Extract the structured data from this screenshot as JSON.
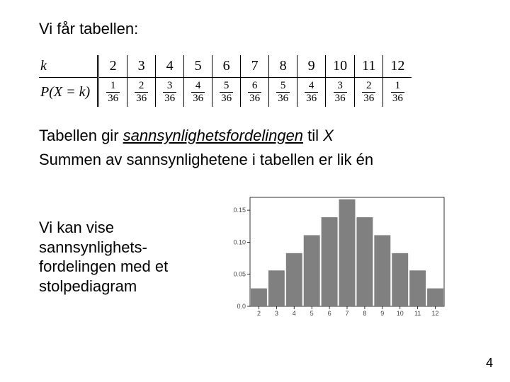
{
  "heading": "Vi får tabellen:",
  "table": {
    "row_label_k": "k",
    "row_label_p": "P(X = k)",
    "k": [
      "2",
      "3",
      "4",
      "5",
      "6",
      "7",
      "8",
      "9",
      "10",
      "11",
      "12"
    ],
    "p_num": [
      "1",
      "2",
      "3",
      "4",
      "5",
      "6",
      "5",
      "4",
      "3",
      "2",
      "1"
    ],
    "p_den": [
      "36",
      "36",
      "36",
      "36",
      "36",
      "36",
      "36",
      "36",
      "36",
      "36",
      "36"
    ]
  },
  "line2_a": "Tabellen gir ",
  "line2_b": "sannsynlighetsfordelingen",
  "line2_c": " til ",
  "line2_d": "X",
  "line3": "Summen av sannsynlighetene i tabellen er lik én",
  "lower_text": "Vi kan vise sannsynlighets-fordelingen med et stolpediagram",
  "page_number": "4",
  "chart_data": {
    "type": "bar",
    "categories": [
      "2",
      "3",
      "4",
      "5",
      "6",
      "7",
      "8",
      "9",
      "10",
      "11",
      "12"
    ],
    "values": [
      0.028,
      0.056,
      0.083,
      0.111,
      0.139,
      0.167,
      0.139,
      0.111,
      0.083,
      0.056,
      0.028
    ],
    "title": "",
    "xlabel": "",
    "ylabel": "",
    "yticks": [
      "0.0",
      "0.05",
      "0.10",
      "0.15"
    ],
    "ylim": [
      0,
      0.17
    ],
    "bar_color": "#808080"
  }
}
